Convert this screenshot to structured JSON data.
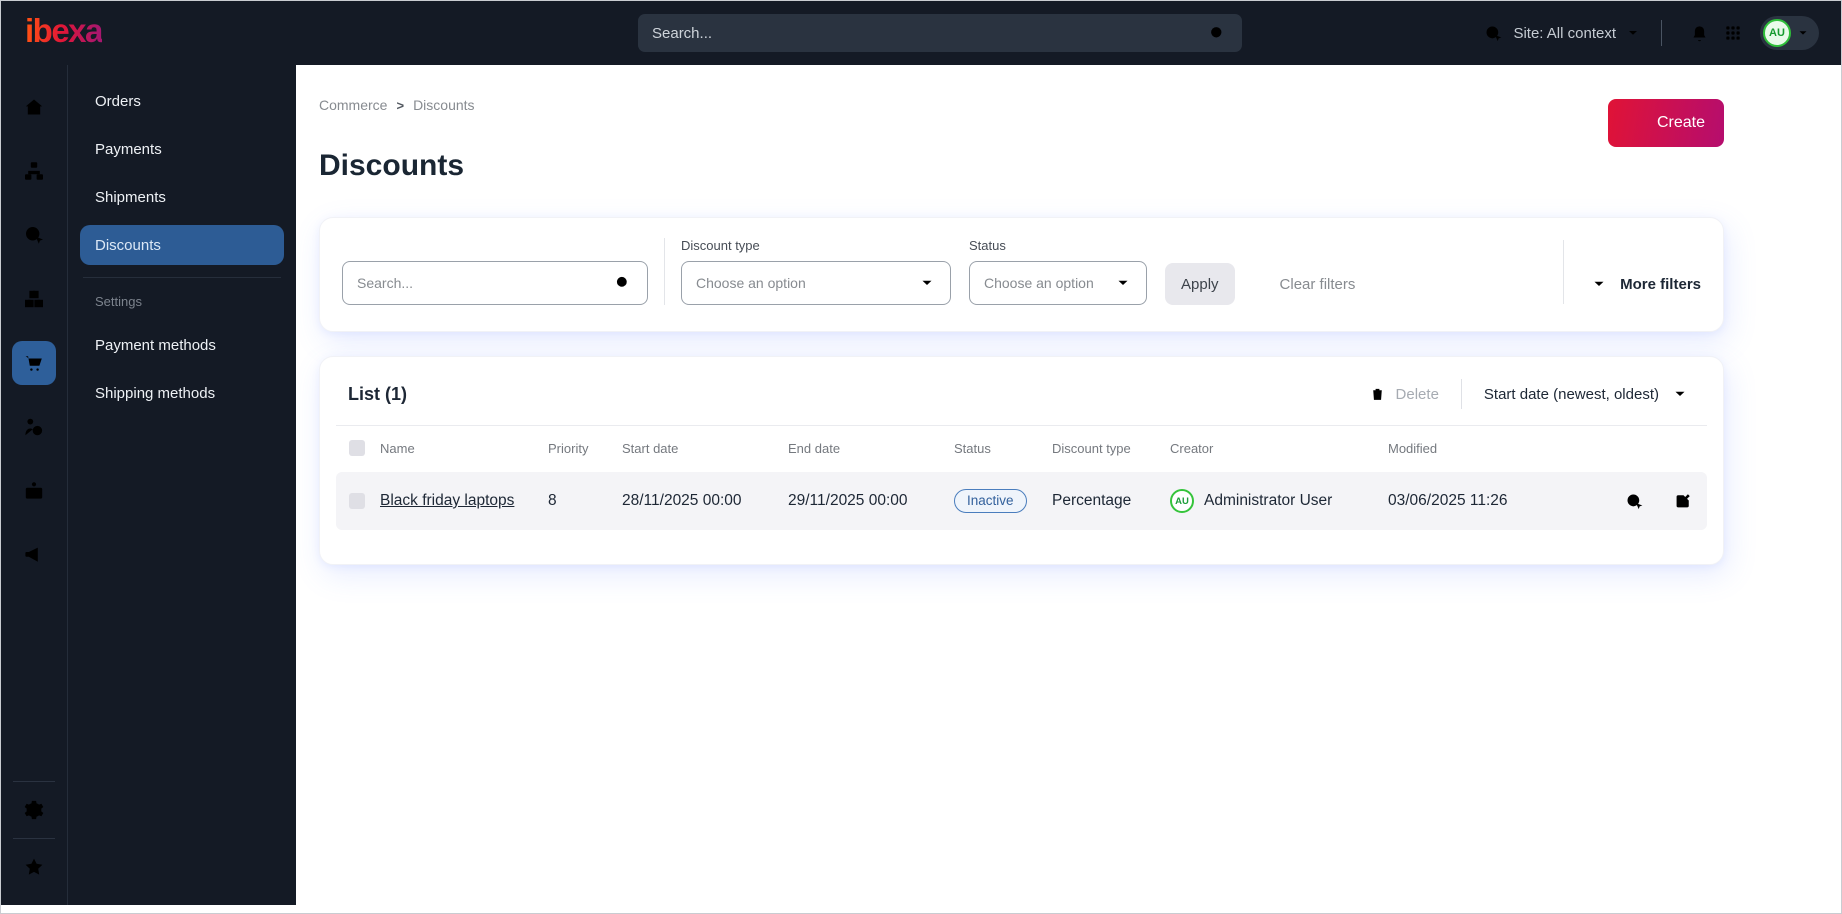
{
  "topbar": {
    "logo_text": "ibexa",
    "search_placeholder": "Search...",
    "site_label": "Site: All context",
    "avatar_initials": "AU"
  },
  "nav_rail": {
    "items": [
      "home",
      "content-tree",
      "site",
      "products",
      "commerce",
      "customers",
      "company",
      "promotions"
    ],
    "active_item": "commerce",
    "footer_items": [
      "settings",
      "favorites"
    ]
  },
  "sidebar": {
    "items": [
      {
        "label": "Orders",
        "active": false
      },
      {
        "label": "Payments",
        "active": false
      },
      {
        "label": "Shipments",
        "active": false
      },
      {
        "label": "Discounts",
        "active": true
      }
    ],
    "settings": {
      "heading": "Settings",
      "items": [
        {
          "label": "Payment methods"
        },
        {
          "label": "Shipping methods"
        }
      ]
    }
  },
  "breadcrumb": {
    "items": [
      "Commerce",
      "Discounts"
    ],
    "separator": ">"
  },
  "page": {
    "title": "Discounts",
    "create_button": "Create"
  },
  "filters": {
    "search_placeholder": "Search...",
    "discount_type": {
      "label": "Discount type",
      "value": "Choose an option"
    },
    "status": {
      "label": "Status",
      "value": "Choose an option"
    },
    "apply_button": "Apply",
    "clear_button": "Clear filters",
    "more_button": "More filters"
  },
  "list": {
    "title": "List (1)",
    "delete_button": "Delete",
    "sort_button": "Start date (newest, oldest)",
    "columns": [
      "Name",
      "Priority",
      "Start date",
      "End date",
      "Status",
      "Discount type",
      "Creator",
      "Modified"
    ],
    "rows": [
      {
        "name": "Black friday laptops",
        "priority": "8",
        "start_date": "28/11/2025 00:00",
        "end_date": "29/11/2025 00:00",
        "status": "Inactive",
        "discount_type": "Percentage",
        "creator_initials": "AU",
        "creator": "Administrator User",
        "modified": "03/06/2025 11:26"
      }
    ]
  },
  "colors": {
    "topbar_bg": "#141a25",
    "nav_active_blue": "#2e5f9a",
    "menu_active_blue": "#2d5c95",
    "create_gradient_start": "#e01336",
    "create_gradient_end": "#b50d6e",
    "logo_gradient_start": "#ff4d15",
    "logo_gradient_end": "#a8176e",
    "status_inactive_text": "#33619c",
    "status_inactive_border": "#4a7dbd",
    "status_inactive_bg": "#eff4fb",
    "avatar_green": "#2fbf3a",
    "row_bg": "#f4f4f7"
  }
}
